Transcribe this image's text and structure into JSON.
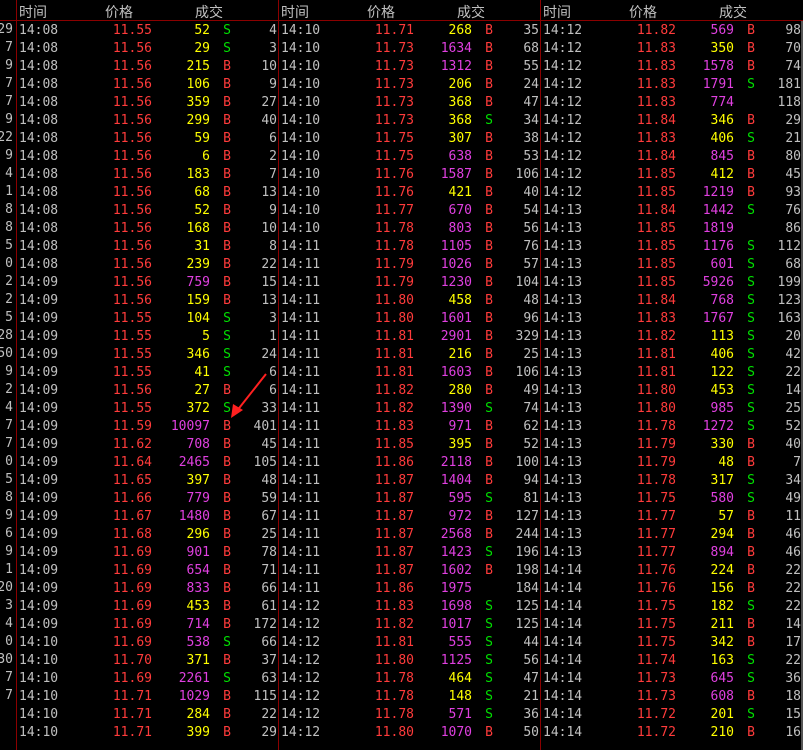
{
  "colors": {
    "price": "#ff3b3b",
    "buy": "#ff3b3b",
    "sell": "#00e000",
    "small_vol": "#ffff00",
    "large_vol": "#e040e0",
    "grid": "#8b0000",
    "bg": "#000000"
  },
  "headers": [
    {
      "time": "时间",
      "price": "价格",
      "volume": "成交"
    },
    {
      "time": "时间",
      "price": "价格",
      "volume": "成交"
    },
    {
      "time": "时间",
      "price": "价格",
      "volume": "成交"
    }
  ],
  "left_cut": [
    "29",
    "7",
    "9",
    "7",
    "7",
    "9",
    "22",
    "9",
    "4",
    "1",
    "8",
    "8",
    "5",
    "0",
    "2",
    "2",
    "5",
    "28",
    "50",
    "9",
    "2",
    "4",
    "7",
    "7",
    "0",
    "5",
    "8",
    "9",
    "6",
    "9",
    "1",
    "20",
    "3",
    "4",
    "0",
    "30",
    "7",
    "7"
  ],
  "columns": [
    [
      [
        "14:08",
        "11.55",
        "52",
        "S",
        "4"
      ],
      [
        "14:08",
        "11.56",
        "29",
        "S",
        "3"
      ],
      [
        "14:08",
        "11.56",
        "215",
        "B",
        "10"
      ],
      [
        "14:08",
        "11.56",
        "106",
        "B",
        "9"
      ],
      [
        "14:08",
        "11.56",
        "359",
        "B",
        "27"
      ],
      [
        "14:08",
        "11.56",
        "299",
        "B",
        "40"
      ],
      [
        "14:08",
        "11.56",
        "59",
        "B",
        "6"
      ],
      [
        "14:08",
        "11.56",
        "6",
        "B",
        "2"
      ],
      [
        "14:08",
        "11.56",
        "183",
        "B",
        "7"
      ],
      [
        "14:08",
        "11.56",
        "68",
        "B",
        "13"
      ],
      [
        "14:08",
        "11.56",
        "52",
        "B",
        "9"
      ],
      [
        "14:08",
        "11.56",
        "168",
        "B",
        "10"
      ],
      [
        "14:08",
        "11.56",
        "31",
        "B",
        "8"
      ],
      [
        "14:08",
        "11.56",
        "239",
        "B",
        "22"
      ],
      [
        "14:09",
        "11.56",
        "759",
        "B",
        "15"
      ],
      [
        "14:09",
        "11.56",
        "159",
        "B",
        "13"
      ],
      [
        "14:09",
        "11.55",
        "104",
        "S",
        "3"
      ],
      [
        "14:09",
        "11.55",
        "5",
        "S",
        "1"
      ],
      [
        "14:09",
        "11.55",
        "346",
        "S",
        "24"
      ],
      [
        "14:09",
        "11.55",
        "41",
        "S",
        "6"
      ],
      [
        "14:09",
        "11.56",
        "27",
        "B",
        "6"
      ],
      [
        "14:09",
        "11.55",
        "372",
        "S",
        "33"
      ],
      [
        "14:09",
        "11.59",
        "10097",
        "B",
        "401"
      ],
      [
        "14:09",
        "11.62",
        "708",
        "B",
        "45"
      ],
      [
        "14:09",
        "11.64",
        "2465",
        "B",
        "105"
      ],
      [
        "14:09",
        "11.65",
        "397",
        "B",
        "48"
      ],
      [
        "14:09",
        "11.66",
        "779",
        "B",
        "59"
      ],
      [
        "14:09",
        "11.67",
        "1480",
        "B",
        "67"
      ],
      [
        "14:09",
        "11.68",
        "296",
        "B",
        "25"
      ],
      [
        "14:09",
        "11.69",
        "901",
        "B",
        "78"
      ],
      [
        "14:09",
        "11.69",
        "654",
        "B",
        "71"
      ],
      [
        "14:09",
        "11.69",
        "833",
        "B",
        "66"
      ],
      [
        "14:09",
        "11.69",
        "453",
        "B",
        "61"
      ],
      [
        "14:09",
        "11.69",
        "714",
        "B",
        "172"
      ],
      [
        "14:10",
        "11.69",
        "538",
        "S",
        "66"
      ],
      [
        "14:10",
        "11.70",
        "371",
        "B",
        "37"
      ],
      [
        "14:10",
        "11.69",
        "2261",
        "S",
        "63"
      ],
      [
        "14:10",
        "11.71",
        "1029",
        "B",
        "115"
      ],
      [
        "14:10",
        "11.71",
        "284",
        "B",
        "22"
      ],
      [
        "14:10",
        "11.71",
        "399",
        "B",
        "29"
      ]
    ],
    [
      [
        "14:10",
        "11.71",
        "268",
        "B",
        "35"
      ],
      [
        "14:10",
        "11.73",
        "1634",
        "B",
        "68"
      ],
      [
        "14:10",
        "11.73",
        "1312",
        "B",
        "55"
      ],
      [
        "14:10",
        "11.73",
        "206",
        "B",
        "24"
      ],
      [
        "14:10",
        "11.73",
        "368",
        "B",
        "47"
      ],
      [
        "14:10",
        "11.73",
        "368",
        "S",
        "34"
      ],
      [
        "14:10",
        "11.75",
        "307",
        "B",
        "38"
      ],
      [
        "14:10",
        "11.75",
        "638",
        "B",
        "53"
      ],
      [
        "14:10",
        "11.76",
        "1587",
        "B",
        "106"
      ],
      [
        "14:10",
        "11.76",
        "421",
        "B",
        "40"
      ],
      [
        "14:10",
        "11.77",
        "670",
        "B",
        "54"
      ],
      [
        "14:10",
        "11.78",
        "803",
        "B",
        "56"
      ],
      [
        "14:11",
        "11.78",
        "1105",
        "B",
        "76"
      ],
      [
        "14:11",
        "11.79",
        "1026",
        "B",
        "57"
      ],
      [
        "14:11",
        "11.79",
        "1230",
        "B",
        "104"
      ],
      [
        "14:11",
        "11.80",
        "458",
        "B",
        "48"
      ],
      [
        "14:11",
        "11.80",
        "1601",
        "B",
        "96"
      ],
      [
        "14:11",
        "11.81",
        "2901",
        "B",
        "329"
      ],
      [
        "14:11",
        "11.81",
        "216",
        "B",
        "25"
      ],
      [
        "14:11",
        "11.81",
        "1603",
        "B",
        "106"
      ],
      [
        "14:11",
        "11.82",
        "280",
        "B",
        "49"
      ],
      [
        "14:11",
        "11.82",
        "1390",
        "S",
        "74"
      ],
      [
        "14:11",
        "11.83",
        "971",
        "B",
        "62"
      ],
      [
        "14:11",
        "11.85",
        "395",
        "B",
        "52"
      ],
      [
        "14:11",
        "11.86",
        "2118",
        "B",
        "100"
      ],
      [
        "14:11",
        "11.87",
        "1404",
        "B",
        "94"
      ],
      [
        "14:11",
        "11.87",
        "595",
        "S",
        "81"
      ],
      [
        "14:11",
        "11.87",
        "972",
        "B",
        "127"
      ],
      [
        "14:11",
        "11.87",
        "2568",
        "B",
        "244"
      ],
      [
        "14:11",
        "11.87",
        "1423",
        "S",
        "196"
      ],
      [
        "14:11",
        "11.87",
        "1602",
        "B",
        "198"
      ],
      [
        "14:11",
        "11.86",
        "1975",
        "",
        "184"
      ],
      [
        "14:12",
        "11.83",
        "1698",
        "S",
        "125"
      ],
      [
        "14:12",
        "11.82",
        "1017",
        "S",
        "125"
      ],
      [
        "14:12",
        "11.81",
        "555",
        "S",
        "44"
      ],
      [
        "14:12",
        "11.80",
        "1125",
        "S",
        "56"
      ],
      [
        "14:12",
        "11.78",
        "464",
        "S",
        "47"
      ],
      [
        "14:12",
        "11.78",
        "148",
        "S",
        "21"
      ],
      [
        "14:12",
        "11.78",
        "571",
        "S",
        "36"
      ],
      [
        "14:12",
        "11.80",
        "1070",
        "B",
        "50"
      ]
    ],
    [
      [
        "14:12",
        "11.82",
        "569",
        "B",
        "98"
      ],
      [
        "14:12",
        "11.83",
        "350",
        "B",
        "70"
      ],
      [
        "14:12",
        "11.83",
        "1578",
        "B",
        "74"
      ],
      [
        "14:12",
        "11.83",
        "1791",
        "S",
        "181"
      ],
      [
        "14:12",
        "11.83",
        "774",
        "",
        "118"
      ],
      [
        "14:12",
        "11.84",
        "346",
        "B",
        "29"
      ],
      [
        "14:12",
        "11.83",
        "406",
        "S",
        "21"
      ],
      [
        "14:12",
        "11.84",
        "845",
        "B",
        "80"
      ],
      [
        "14:12",
        "11.85",
        "412",
        "B",
        "45"
      ],
      [
        "14:12",
        "11.85",
        "1219",
        "B",
        "93"
      ],
      [
        "14:13",
        "11.84",
        "1442",
        "S",
        "76"
      ],
      [
        "14:13",
        "11.85",
        "1819",
        "",
        "86"
      ],
      [
        "14:13",
        "11.85",
        "1176",
        "S",
        "112"
      ],
      [
        "14:13",
        "11.85",
        "601",
        "S",
        "68"
      ],
      [
        "14:13",
        "11.85",
        "5926",
        "S",
        "199"
      ],
      [
        "14:13",
        "11.84",
        "768",
        "S",
        "123"
      ],
      [
        "14:13",
        "11.83",
        "1767",
        "S",
        "163"
      ],
      [
        "14:13",
        "11.82",
        "113",
        "S",
        "20"
      ],
      [
        "14:13",
        "11.81",
        "406",
        "S",
        "42"
      ],
      [
        "14:13",
        "11.81",
        "122",
        "S",
        "22"
      ],
      [
        "14:13",
        "11.80",
        "453",
        "S",
        "14"
      ],
      [
        "14:13",
        "11.80",
        "985",
        "S",
        "25"
      ],
      [
        "14:13",
        "11.78",
        "1272",
        "S",
        "52"
      ],
      [
        "14:13",
        "11.79",
        "330",
        "B",
        "40"
      ],
      [
        "14:13",
        "11.79",
        "48",
        "B",
        "7"
      ],
      [
        "14:13",
        "11.78",
        "317",
        "S",
        "34"
      ],
      [
        "14:13",
        "11.75",
        "580",
        "S",
        "49"
      ],
      [
        "14:13",
        "11.77",
        "57",
        "B",
        "11"
      ],
      [
        "14:13",
        "11.77",
        "294",
        "B",
        "46"
      ],
      [
        "14:13",
        "11.77",
        "894",
        "B",
        "46"
      ],
      [
        "14:14",
        "11.76",
        "224",
        "B",
        "22"
      ],
      [
        "14:14",
        "11.76",
        "156",
        "B",
        "22"
      ],
      [
        "14:14",
        "11.75",
        "182",
        "S",
        "22"
      ],
      [
        "14:14",
        "11.75",
        "211",
        "B",
        "14"
      ],
      [
        "14:14",
        "11.75",
        "342",
        "B",
        "17"
      ],
      [
        "14:14",
        "11.74",
        "163",
        "S",
        "22"
      ],
      [
        "14:14",
        "11.73",
        "645",
        "S",
        "36"
      ],
      [
        "14:14",
        "11.73",
        "608",
        "B",
        "18"
      ],
      [
        "14:14",
        "11.72",
        "201",
        "S",
        "15"
      ],
      [
        "14:14",
        "11.72",
        "210",
        "B",
        "16"
      ]
    ]
  ]
}
